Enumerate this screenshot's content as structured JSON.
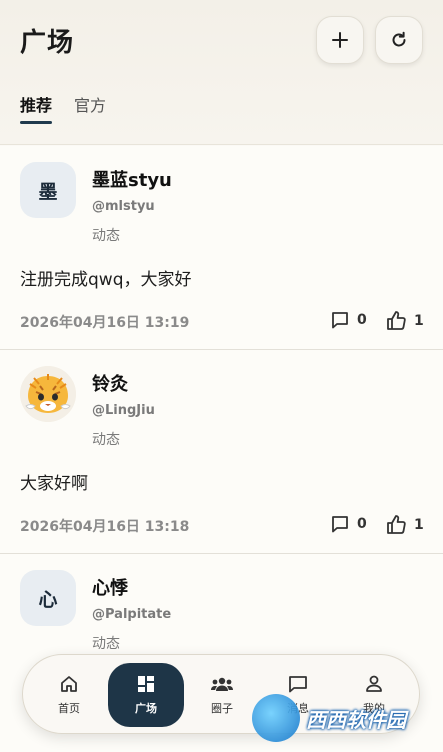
{
  "header": {
    "title": "广场",
    "add_icon": "plus-icon",
    "refresh_icon": "refresh-icon",
    "tabs": [
      {
        "label": "推荐",
        "active": true
      },
      {
        "label": "官方",
        "active": false
      }
    ]
  },
  "posts": [
    {
      "avatar_text": "墨",
      "username": "墨蓝styu",
      "handle": "@mlstyu",
      "type": "动态",
      "content": "注册完成qwq，大家好",
      "time": "2026年04月16日 13:19",
      "comments": "0",
      "likes": "1"
    },
    {
      "avatar_text": "",
      "avatar_image": "tiger-cartoon-avatar",
      "username": "铃灸",
      "handle": "@LingJiu",
      "type": "动态",
      "content": "大家好啊",
      "time": "2026年04月16日 13:18",
      "comments": "0",
      "likes": "1"
    },
    {
      "avatar_text": "心",
      "username": "心悸",
      "handle": "@Palpitate",
      "type": "动态",
      "content": "",
      "time": "",
      "comments": "",
      "likes": ""
    }
  ],
  "nav": {
    "items": [
      {
        "label": "首页",
        "icon": "home-icon",
        "active": false
      },
      {
        "label": "广场",
        "icon": "dashboard-icon",
        "active": true
      },
      {
        "label": "圈子",
        "icon": "group-icon",
        "active": false
      },
      {
        "label": "消息",
        "icon": "message-icon",
        "active": false
      },
      {
        "label": "我的",
        "icon": "person-icon",
        "active": false
      }
    ]
  },
  "watermark": {
    "text": "西西软件园"
  },
  "colors": {
    "accent": "#1e3547",
    "background": "#fbf9f5",
    "muted_text": "#7a7a7a"
  }
}
